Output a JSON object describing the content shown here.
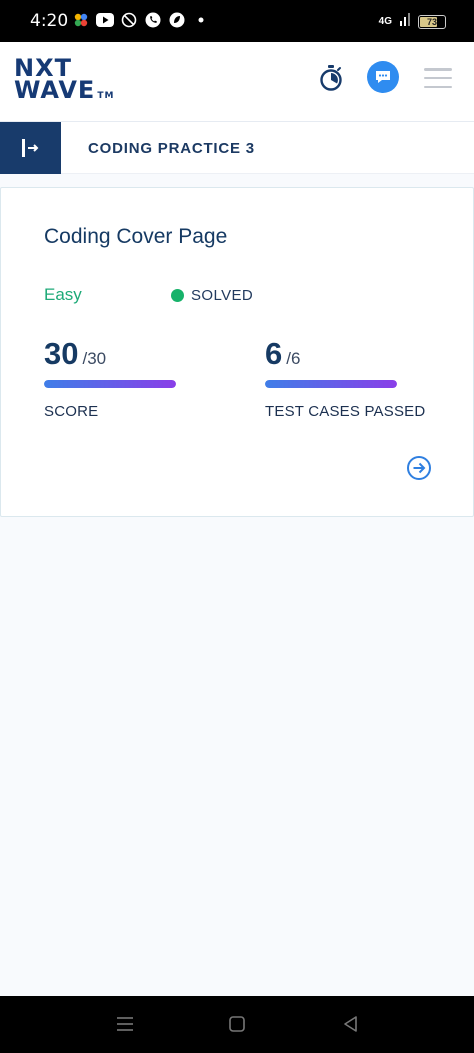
{
  "status_bar": {
    "time": "4:20",
    "network": "4G",
    "battery": "73",
    "battery_level": 0.73,
    "notification_icons": [
      "pinwheel-icon",
      "youtube-icon",
      "no-entry-icon",
      "phone-icon",
      "leaf-icon",
      "dot-icon"
    ]
  },
  "header": {
    "logo_line1": "NXT",
    "logo_line2": "WAVE",
    "logo_tm": "TM",
    "icons": [
      "timer-icon",
      "chat-icon",
      "hamburger-menu-icon"
    ]
  },
  "section": {
    "title": "CODING PRACTICE 3",
    "icon": "collapse-sidebar-icon"
  },
  "card": {
    "title": "Coding Cover Page",
    "difficulty": "Easy",
    "status": "SOLVED",
    "score": {
      "value": "30",
      "total": "/30",
      "label": "SCORE",
      "progress": 1.0
    },
    "tests": {
      "value": "6",
      "total": "/6",
      "label": "TEST CASES PASSED",
      "progress": 1.0
    },
    "action_icon": "arrow-circle-right-icon"
  },
  "colors": {
    "brand_navy": "#183b6b",
    "accent_blue": "#2f8cf0",
    "easy_green": "#1eaa78",
    "solved_green": "#17b26a",
    "progress_start": "#3f7ee8",
    "progress_end": "#8a3ee8"
  },
  "nav_bar": {
    "icons": [
      "recent-apps-icon",
      "home-icon",
      "back-icon"
    ]
  }
}
